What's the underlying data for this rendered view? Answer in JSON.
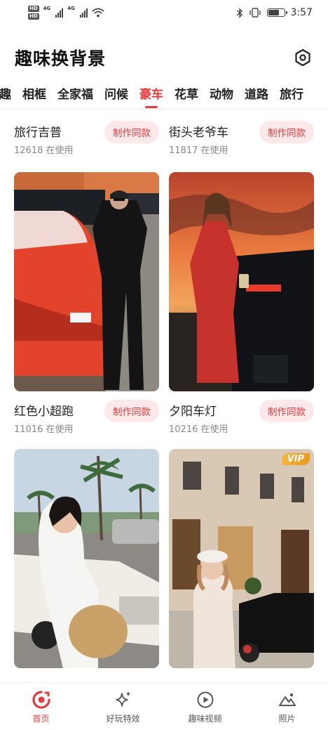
{
  "status_bar": {
    "hd1": "HD",
    "hd2": "HD",
    "net1": "4G",
    "net2": "4G",
    "time": "3:57",
    "battery_level": 0.7
  },
  "header": {
    "title": "趣味换背景",
    "settings_icon": "gear-hexagon-icon"
  },
  "tabs": [
    {
      "label": "趣",
      "active": false
    },
    {
      "label": "相框",
      "active": false
    },
    {
      "label": "全家福",
      "active": false
    },
    {
      "label": "问候",
      "active": false
    },
    {
      "label": "豪车",
      "active": true
    },
    {
      "label": "花草",
      "active": false
    },
    {
      "label": "动物",
      "active": false
    },
    {
      "label": "道路",
      "active": false
    },
    {
      "label": "旅行",
      "active": false
    }
  ],
  "cards": [
    {
      "name": "旅行吉普",
      "usage": "12618 在使用",
      "button": "制作同款"
    },
    {
      "name": "街头老爷车",
      "usage": "11817 在使用",
      "button": "制作同款"
    },
    {
      "name": "红色小超跑",
      "usage": "11016 在使用",
      "button": "制作同款"
    },
    {
      "name": "夕阳车灯",
      "usage": "10216 在使用",
      "button": "制作同款"
    }
  ],
  "vip_label": "VIP",
  "bottom_nav": [
    {
      "label": "首页",
      "icon": "home-swirl-icon",
      "active": true
    },
    {
      "label": "好玩特效",
      "icon": "sparkle-icon",
      "active": false
    },
    {
      "label": "趣味视频",
      "icon": "play-circle-icon",
      "active": false
    },
    {
      "label": "照片",
      "icon": "mountain-photo-icon",
      "active": false
    }
  ],
  "colors": {
    "accent": "#e23c3c",
    "button_bg": "#fde8ea",
    "vip": "#f3b63a"
  }
}
